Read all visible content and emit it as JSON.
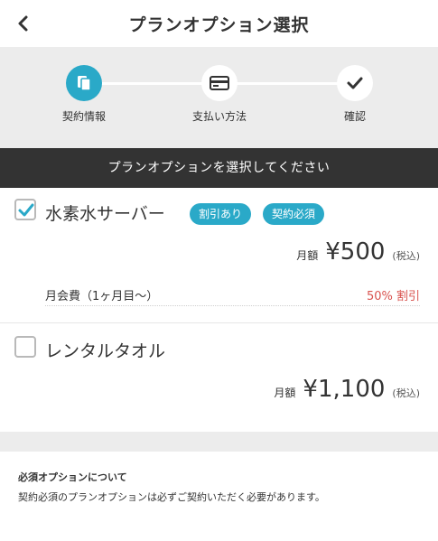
{
  "header": {
    "title": "プランオプション選択",
    "back_icon": "chevron-left-icon"
  },
  "steps": [
    {
      "label": "契約情報",
      "icon": "clipboard-icon",
      "active": true
    },
    {
      "label": "支払い方法",
      "icon": "credit-card-icon",
      "active": false
    },
    {
      "label": "確認",
      "icon": "check-icon",
      "active": false
    }
  ],
  "banner": {
    "text": "プランオプションを選択してください"
  },
  "options": [
    {
      "name": "水素水サーバー",
      "checked": true,
      "badges": [
        "割引あり",
        "契約必須"
      ],
      "price_prefix": "月額",
      "price": "¥500",
      "tax": "(税込)",
      "fee_label": "月会費（1ヶ月目〜）",
      "fee_discount": "50% 割引"
    },
    {
      "name": "レンタルタオル",
      "checked": false,
      "price_prefix": "月額",
      "price": "¥1,100",
      "tax": "(税込)"
    }
  ],
  "note": {
    "title": "必須オプションについて",
    "text": "契約必須のプランオプションは必ずご契約いただく必要があります。"
  },
  "colors": {
    "accent": "#2aa9c8",
    "banner": "#333333",
    "discount": "#d9534f",
    "background_gray": "#ececec"
  }
}
